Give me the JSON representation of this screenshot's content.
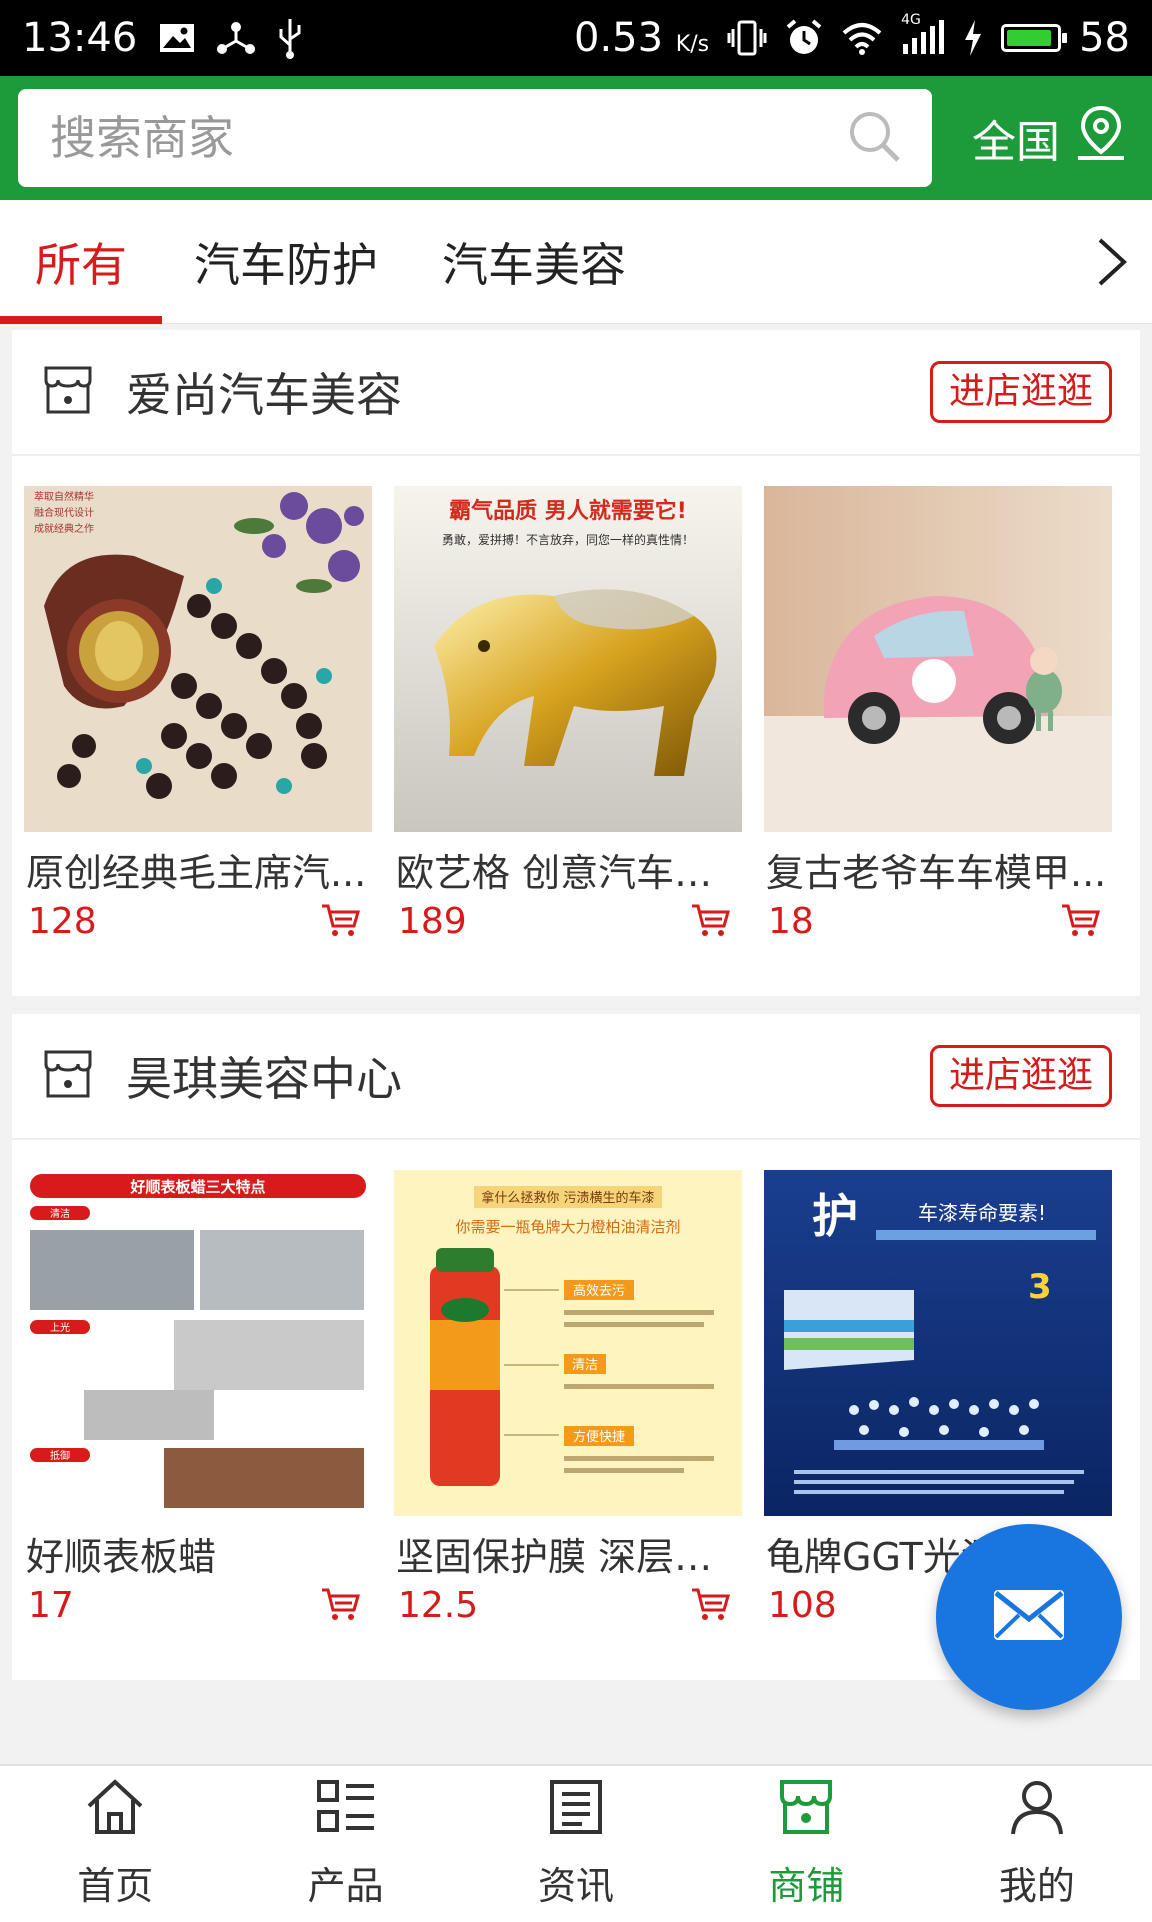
{
  "status_bar": {
    "time": "13:46",
    "speed": "0.53",
    "speed_unit": "K/s",
    "network": "4G",
    "battery": "58",
    "icons": [
      "image-icon",
      "usb-share-icon",
      "usb-icon",
      "vibrate-icon",
      "alarm-icon",
      "wifi-icon",
      "signal-icon",
      "charging-icon",
      "battery-icon"
    ]
  },
  "header": {
    "search_placeholder": "搜索商家",
    "region": "全国",
    "colors": {
      "brand_green": "#1d9a3a"
    }
  },
  "tabs": [
    {
      "label": "所有",
      "active": true
    },
    {
      "label": "汽车防护",
      "active": false
    },
    {
      "label": "汽车美容",
      "active": false
    }
  ],
  "shops": [
    {
      "name": "爱尚汽车美容",
      "enter_label": "进店逛逛",
      "products": [
        {
          "name": "原创经典毛主席汽...",
          "price": "128"
        },
        {
          "name": "欧艺格 创意汽车摆...",
          "price": "189",
          "image_text": [
            "霸气品质 男人就需要它!",
            "勇敢，爱拼搏！不言放弃，同您一样的真性情！"
          ]
        },
        {
          "name": "复古老爷车车模甲...",
          "price": "18"
        }
      ]
    },
    {
      "name": "昊琪美容中心",
      "enter_label": "进店逛逛",
      "products": [
        {
          "name": "好顺表板蜡",
          "price": "17",
          "image_text": [
            "好顺表板蜡三大特点",
            "清洁",
            "上光",
            "抵御"
          ]
        },
        {
          "name": "坚固保护膜 深层锁...",
          "price": "12.5",
          "image_text": [
            "拿什么拯救你 污渍横生的车漆",
            "你需要一瓶龟牌大力橙柏油清洁剂",
            "高效去污",
            "清洁",
            "方便快捷"
          ]
        },
        {
          "name": "龟牌GGT光泽...",
          "price": "108",
          "image_text": [
            "护",
            "车漆寿命要素!",
            "3"
          ]
        }
      ]
    }
  ],
  "bottom_nav": [
    {
      "label": "首页",
      "icon": "home-icon",
      "active": false
    },
    {
      "label": "产品",
      "icon": "list-icon",
      "active": false
    },
    {
      "label": "资讯",
      "icon": "news-icon",
      "active": false
    },
    {
      "label": "商铺",
      "icon": "store-icon",
      "active": true
    },
    {
      "label": "我的",
      "icon": "user-icon",
      "active": false
    }
  ],
  "fab": {
    "icon": "mail-icon"
  }
}
